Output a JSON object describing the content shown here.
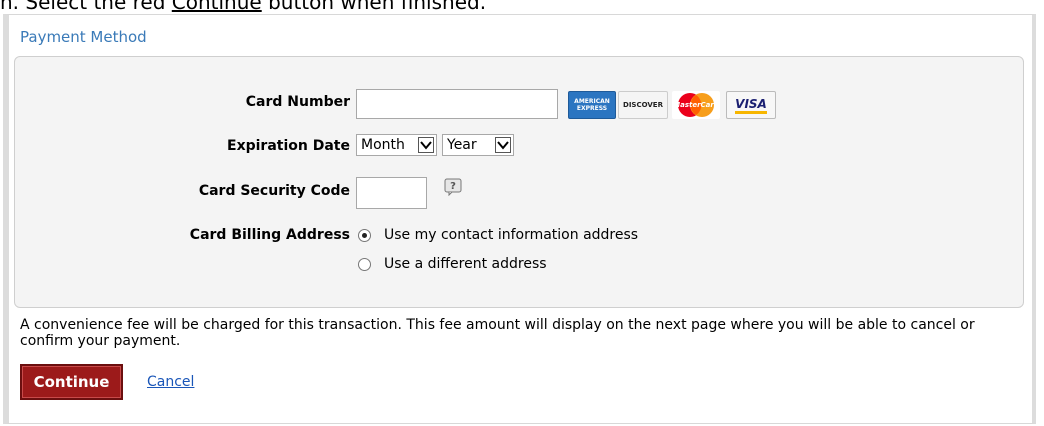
{
  "instruction": {
    "prefix": "n. Select the red ",
    "link_word": "Continue",
    "suffix": " button when finished."
  },
  "section": {
    "title": "Payment Method"
  },
  "form": {
    "card_number_label": "Card Number",
    "card_number_value": "",
    "expiration_label": "Expiration Date",
    "month_select": "Month",
    "year_select": "Year",
    "security_label": "Card Security Code",
    "security_value": "",
    "billing_label": "Card Billing Address",
    "billing_options": [
      {
        "label": "Use my contact information address",
        "selected": true
      },
      {
        "label": "Use a different address",
        "selected": false
      }
    ]
  },
  "cards": {
    "amex": "AMERICAN EXPRESS",
    "discover": "DISCOVER",
    "mastercard": "MasterCard",
    "visa": "VISA"
  },
  "note": "A convenience fee will be charged for this transaction. This fee amount will display on the next page where you will be able to cancel or confirm your payment.",
  "actions": {
    "continue": "Continue",
    "cancel": "Cancel"
  },
  "colors": {
    "title": "#3a7ab8",
    "continue_bg": "#9c1a1a",
    "link": "#1a56b8"
  }
}
